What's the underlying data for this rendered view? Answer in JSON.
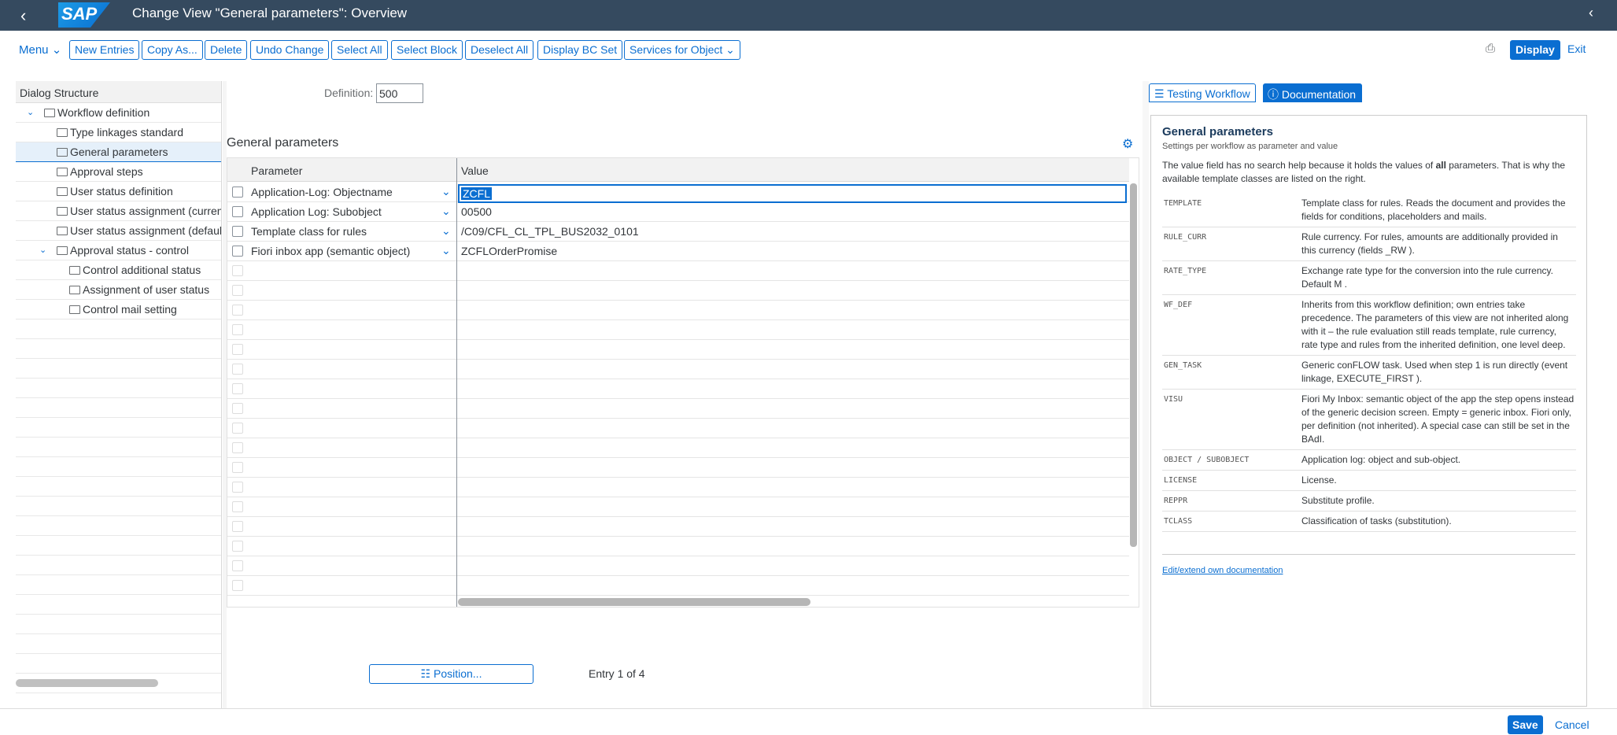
{
  "shell": {
    "title": "Change View \"General parameters\": Overview",
    "logo": "SAP"
  },
  "toolbar": {
    "menu": "Menu",
    "buttons": [
      "New Entries",
      "Copy As...",
      "Delete",
      "Undo Change",
      "Select All",
      "Select Block",
      "Deselect All",
      "Display BC Set",
      "Services for Object"
    ],
    "display": "Display",
    "exit": "Exit"
  },
  "tree": {
    "header": "Dialog Structure",
    "items": [
      "Workflow definition",
      "Type linkages standard",
      "General parameters",
      "Approval steps",
      "User status definition",
      "User status assignment (current",
      "User status assignment (default",
      "Approval status - control",
      "Control additional status",
      "Assignment of user status",
      "Control mail setting"
    ]
  },
  "definition": {
    "label": "Definition:",
    "value": "500"
  },
  "section": {
    "title": "General parameters"
  },
  "grid": {
    "col_param": "Parameter",
    "col_value": "Value",
    "rows": [
      {
        "param": "Application-Log: Objectname",
        "value": "ZCFL"
      },
      {
        "param": "Application Log: Subobject",
        "value": "00500"
      },
      {
        "param": "Template class for rules",
        "value": "/C09/CFL_CL_TPL_BUS2032_0101"
      },
      {
        "param": "Fiori inbox app (semantic object)",
        "value": "ZCFLOrderPromise"
      }
    ]
  },
  "position_button": "Position...",
  "entry_info": "Entry 1 of 4",
  "doc": {
    "tab_testing": "Testing Workflow",
    "tab_documentation": "Documentation",
    "title": "General parameters",
    "subtitle": "Settings per workflow as parameter and value",
    "intro_pre": "The value field has no search help because it holds the values of ",
    "intro_bold": "all",
    "intro_post": " parameters. That is why the available template classes are listed on the right.",
    "entries": [
      {
        "key": "TEMPLATE",
        "text": "Template class for rules. Reads the document and provides the fields for conditions, placeholders and mails."
      },
      {
        "key": "RULE_CURR",
        "text": "Rule currency. For rules, amounts are additionally provided in this currency (fields _RW )."
      },
      {
        "key": "RATE_TYPE",
        "text": "Exchange rate type for the conversion into the rule currency. Default M ."
      },
      {
        "key": "WF_DEF",
        "text": "Inherits from this workflow definition; own entries take precedence. The parameters of this view are not inherited along with it – the rule evaluation still reads template, rule currency, rate type and rules from the inherited definition, one level deep."
      },
      {
        "key": "GEN_TASK",
        "text": "Generic conFLOW task. Used when step 1 is run directly (event linkage, EXECUTE_FIRST )."
      },
      {
        "key": "VISU",
        "text": "Fiori My Inbox: semantic object of the app the step opens instead of the generic decision screen. Empty = generic inbox. Fiori only, per definition (not inherited). A special case can still be set in the BAdI."
      },
      {
        "key": "OBJECT / SUBOBJECT",
        "text": "Application log: object and sub-object."
      },
      {
        "key": "LICENSE",
        "text": "License."
      },
      {
        "key": "REPPR",
        "text": "Substitute profile."
      },
      {
        "key": "TCLASS",
        "text": "Classification of tasks (substitution)."
      }
    ],
    "link": "Edit/extend own documentation"
  },
  "footer": {
    "save": "Save",
    "cancel": "Cancel"
  }
}
